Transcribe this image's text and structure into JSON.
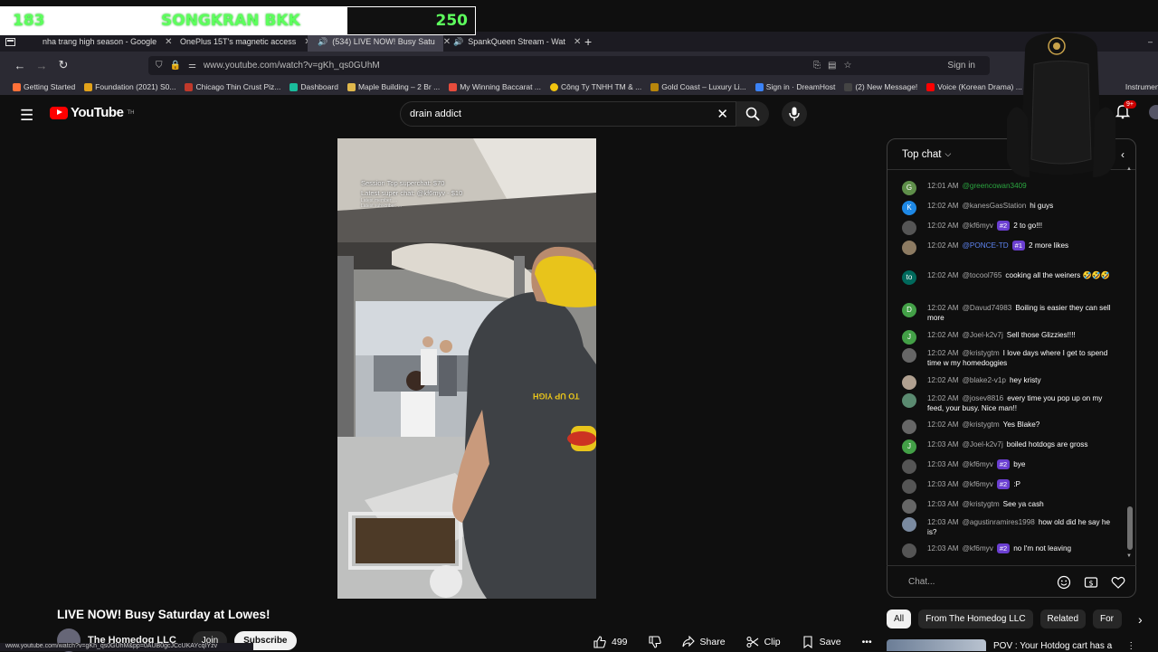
{
  "overlay": {
    "count": "183",
    "title": "SONGKRAN BKK",
    "goal": "250"
  },
  "tabs": [
    {
      "label": "nha trang high season - Google",
      "color": "#4285f4"
    },
    {
      "label": "OnePlus 15T's magnetic access",
      "color": "#aaaaaa"
    },
    {
      "label": "(534) LIVE NOW! Busy Satu",
      "color": "#ff0000"
    },
    {
      "label": "SpankQueen Stream - Wat",
      "color": "#53fc18"
    }
  ],
  "address": {
    "url": "www.youtube.com/watch?v=gKh_qs0GUhM",
    "sign_in": "Sign in"
  },
  "bookmarks": [
    {
      "label": "Getting Started",
      "color": "#ff7139"
    },
    {
      "label": "Foundation (2021) S0...",
      "color": "#e2a21a"
    },
    {
      "label": "Chicago Thin Crust Piz...",
      "color": "#c0392b"
    },
    {
      "label": "Dashboard",
      "color": "#1abc9c"
    },
    {
      "label": "Maple Building – 2 Br ...",
      "color": "#e0b84c"
    },
    {
      "label": "My Winning Baccarat ...",
      "color": "#e74c3c"
    },
    {
      "label": "Công Ty TNHH TM & ...",
      "color": "#f1c40f"
    },
    {
      "label": "Gold Coast – Luxury Li...",
      "color": "#b8860b"
    },
    {
      "label": "Sign in · DreamHost",
      "color": "#3b82f6"
    },
    {
      "label": "(2) New Message!",
      "color": "#444444"
    },
    {
      "label": "Voice (Korean Drama) ...",
      "color": "#ff0000"
    },
    {
      "label": "Instruments T",
      "color": "#888888"
    }
  ],
  "header": {
    "logo": "YouTube",
    "logo_sup": "TH",
    "search_value": "drain addict",
    "notif_count": "9+"
  },
  "video": {
    "overlay_line1": "Session Top superchat: $70",
    "overlay_line2": "Latest super chat: @kf6myv - $10",
    "overlay_small1": "Latest member: ...",
    "overlay_small2": "Latest subscriber: ...",
    "shirt_text": "TO UP YIGH"
  },
  "meta": {
    "title": "LIVE NOW! Busy Saturday at Lowes!",
    "channel": "The Homedog LLC",
    "join": "Join",
    "subscribe": "Subscribe",
    "status_url": "www.youtube.com/watch?v=gKh_qs0GUhM&pp=0AUB0gcJCcUKAYcqIYzv"
  },
  "actions": {
    "likes": "499",
    "share": "Share",
    "clip": "Clip",
    "save": "Save"
  },
  "chat": {
    "mode": "Top chat",
    "placeholder": "Chat...",
    "messages": [
      {
        "time": "12:01 AM",
        "author": "@greencowan3409",
        "text": "",
        "color": "#5f8f4a",
        "initial": "G",
        "style": "green",
        "badge": ""
      },
      {
        "time": "12:02 AM",
        "author": "@kanesGasStation",
        "text": "hi guys",
        "color": "#1e88e5",
        "initial": "K",
        "style": "",
        "badge": ""
      },
      {
        "time": "12:02 AM",
        "author": "@kf6myv",
        "text": "2 to go!!!",
        "color": "#555555",
        "initial": "",
        "style": "",
        "badge": "#2"
      },
      {
        "time": "12:02 AM",
        "author": "@PONCE-TD",
        "text": "2 more likes",
        "color": "#8d7b62",
        "initial": "",
        "style": "mod",
        "badge": "#1"
      },
      {
        "time": "12:02 AM",
        "author": "@tocool765",
        "text": "cooking all the weiners 🤣🤣🤣",
        "color": "#00695c",
        "initial": "to",
        "style": "",
        "badge": ""
      },
      {
        "time": "12:02 AM",
        "author": "@Davud74983",
        "text": "Boiling is easier they can sell more",
        "color": "#43a047",
        "initial": "D",
        "style": "",
        "badge": ""
      },
      {
        "time": "12:02 AM",
        "author": "@Joel-k2v7j",
        "text": "Sell those Glizzies!!!!",
        "color": "#43a047",
        "initial": "J",
        "style": "",
        "badge": ""
      },
      {
        "time": "12:02 AM",
        "author": "@kristygtm",
        "text": "I love days where I get to spend time w my homedoggies",
        "color": "#666666",
        "initial": "",
        "style": "",
        "badge": ""
      },
      {
        "time": "12:02 AM",
        "author": "@blake2-v1p",
        "text": "hey kristy",
        "color": "#b0a090",
        "initial": "",
        "style": "",
        "badge": ""
      },
      {
        "time": "12:02 AM",
        "author": "@josev8816",
        "text": "every time you pop up on my feed, your busy. Nice man!!",
        "color": "#5a8a70",
        "initial": "",
        "style": "",
        "badge": ""
      },
      {
        "time": "12:02 AM",
        "author": "@kristygtm",
        "text": "Yes Blake?",
        "color": "#666666",
        "initial": "",
        "style": "",
        "badge": ""
      },
      {
        "time": "12:03 AM",
        "author": "@Joel-k2v7j",
        "text": "boiled hotdogs are gross",
        "color": "#43a047",
        "initial": "J",
        "style": "",
        "badge": ""
      },
      {
        "time": "12:03 AM",
        "author": "@kf6myv",
        "text": "bye",
        "color": "#555555",
        "initial": "",
        "style": "",
        "badge": "#2"
      },
      {
        "time": "12:03 AM",
        "author": "@kf6myv",
        "text": ":P",
        "color": "#555555",
        "initial": "",
        "style": "",
        "badge": "#2"
      },
      {
        "time": "12:03 AM",
        "author": "@kristygtm",
        "text": "See ya cash",
        "color": "#666666",
        "initial": "",
        "style": "",
        "badge": ""
      },
      {
        "time": "12:03 AM",
        "author": "@agustinramires1998",
        "text": "how old did he say he is?",
        "color": "#7a8aa0",
        "initial": "",
        "style": "",
        "badge": ""
      },
      {
        "time": "12:03 AM",
        "author": "@kf6myv",
        "text": "no I'm not leaving",
        "color": "#555555",
        "initial": "",
        "style": "",
        "badge": "#2"
      }
    ]
  },
  "chips": [
    "All",
    "From The Homedog LLC",
    "Related",
    "For"
  ],
  "recommendation": {
    "title": "POV : Your Hotdog cart has a"
  }
}
